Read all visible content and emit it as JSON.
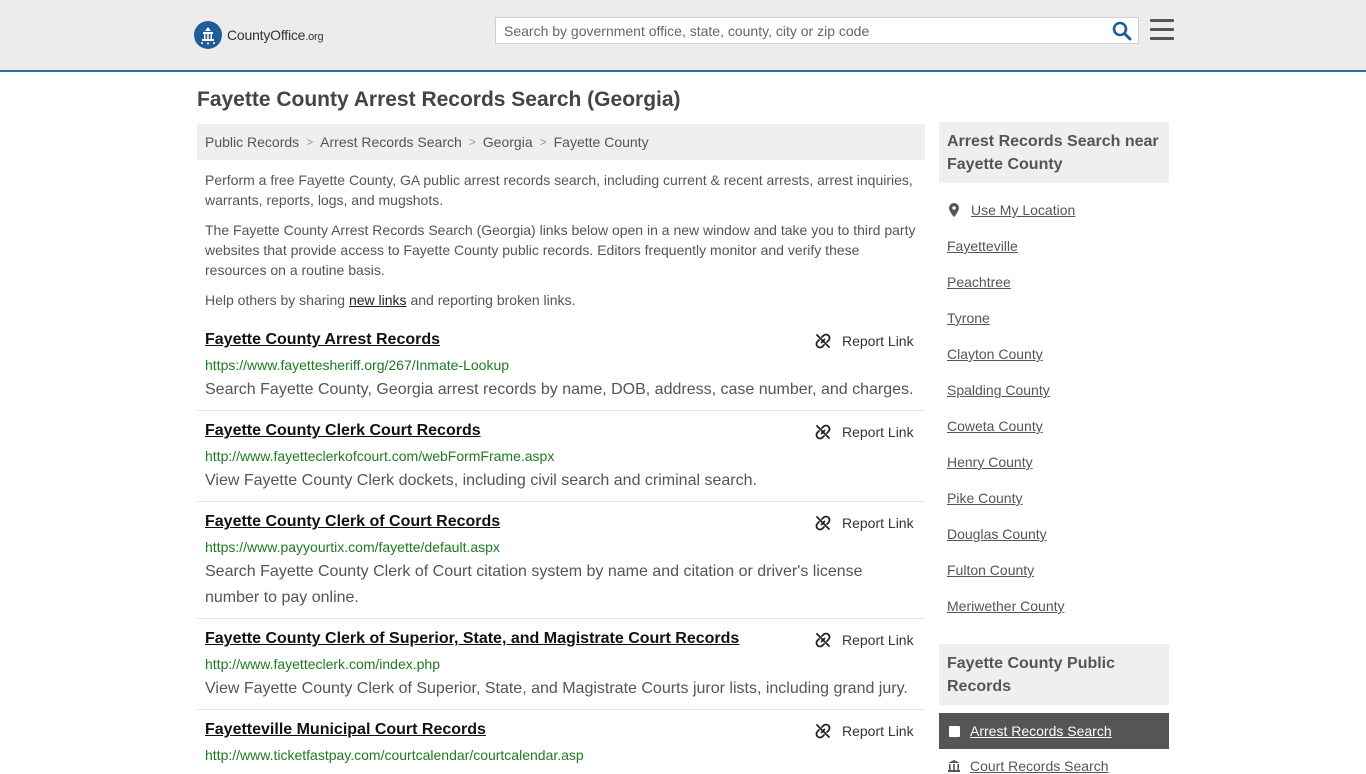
{
  "header": {
    "logo_text": "CountyOffice",
    "logo_suffix": ".org",
    "search_placeholder": "Search by government office, state, county, city or zip code"
  },
  "page": {
    "title": "Fayette County Arrest Records Search (Georgia)"
  },
  "breadcrumb": [
    "Public Records",
    "Arrest Records Search",
    "Georgia",
    "Fayette County"
  ],
  "intro": {
    "p1": "Perform a free Fayette County, GA public arrest records search, including current & recent arrests, arrest inquiries, warrants, reports, logs, and mugshots.",
    "p2": "The Fayette County Arrest Records Search (Georgia) links below open in a new window and take you to third party websites that provide access to Fayette County public records. Editors frequently monitor and verify these resources on a routine basis.",
    "p3_before": "Help others by sharing ",
    "p3_link": "new links",
    "p3_after": " and reporting broken links."
  },
  "report_label": "Report Link",
  "results": [
    {
      "title": "Fayette County Arrest Records",
      "url": "https://www.fayettesheriff.org/267/Inmate-Lookup",
      "desc": "Search Fayette County, Georgia arrest records by name, DOB, address, case number, and charges."
    },
    {
      "title": "Fayette County Clerk Court Records",
      "url": "http://www.fayetteclerkofcourt.com/webFormFrame.aspx",
      "desc": "View Fayette County Clerk dockets, including civil search and criminal search."
    },
    {
      "title": "Fayette County Clerk of Court Records",
      "url": "https://www.payyourtix.com/fayette/default.aspx",
      "desc": "Search Fayette County Clerk of Court citation system by name and citation or driver's license number to pay online."
    },
    {
      "title": "Fayette County Clerk of Superior, State, and Magistrate Court Records",
      "url": "http://www.fayetteclerk.com/index.php",
      "desc": "View Fayette County Clerk of Superior, State, and Magistrate Courts juror lists, including grand jury."
    },
    {
      "title": "Fayetteville Municipal Court Records",
      "url": "http://www.ticketfastpay.com/courtcalendar/courtcalendar.asp",
      "desc": ""
    }
  ],
  "sidebar": {
    "nearby_heading": "Arrest Records Search near Fayette County",
    "use_location": "Use My Location",
    "nearby": [
      "Fayetteville",
      "Peachtree",
      "Tyrone",
      "Clayton County",
      "Spalding County",
      "Coweta County",
      "Henry County",
      "Pike County",
      "Douglas County",
      "Fulton County",
      "Meriwether County"
    ],
    "public_heading": "Fayette County Public Records",
    "active_item": "Arrest Records Search",
    "next_item": "Court Records Search"
  }
}
